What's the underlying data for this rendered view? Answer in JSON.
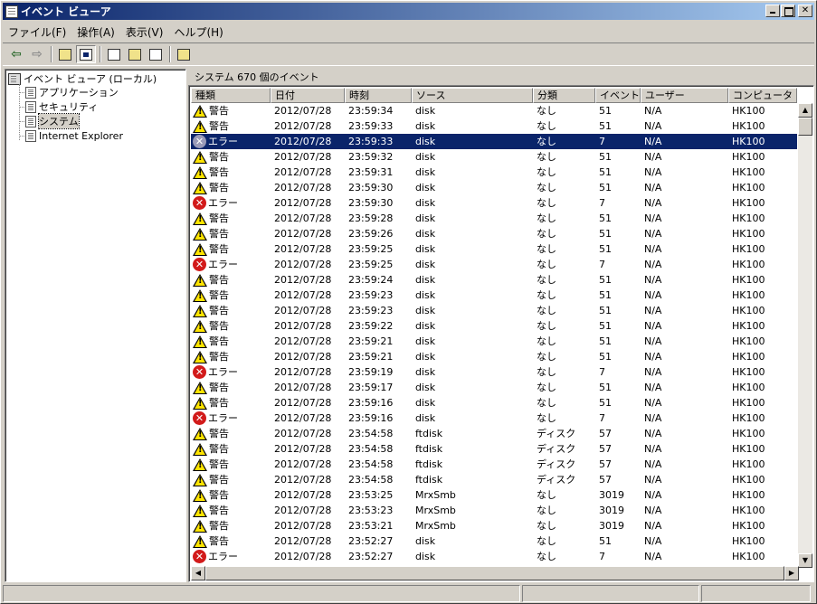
{
  "window": {
    "title": "イベント ビューア"
  },
  "menu": [
    "ファイル(F)",
    "操作(A)",
    "表示(V)",
    "ヘルプ(H)"
  ],
  "tree": {
    "root": "イベント ビューア (ローカル)",
    "items": [
      "アプリケーション",
      "セキュリティ",
      "システム",
      "Internet Explorer"
    ],
    "selected_index": 2
  },
  "pane": {
    "header": "システム    670 個のイベント"
  },
  "columns": [
    "種類",
    "日付",
    "時刻",
    "ソース",
    "分類",
    "イベント",
    "ユーザー",
    "コンピュータ"
  ],
  "colors": {
    "selection": "#0a246a",
    "error": "#d21a1a",
    "warning": "#ffe400"
  },
  "icons": {
    "warning": "warning-icon",
    "error": "error-icon"
  },
  "selected_row": 2,
  "rows": [
    {
      "type": "warning",
      "label": "警告",
      "date": "2012/07/28",
      "time": "23:59:34",
      "source": "disk",
      "category": "なし",
      "event": "51",
      "user": "N/A",
      "computer": "HK100"
    },
    {
      "type": "warning",
      "label": "警告",
      "date": "2012/07/28",
      "time": "23:59:33",
      "source": "disk",
      "category": "なし",
      "event": "51",
      "user": "N/A",
      "computer": "HK100"
    },
    {
      "type": "error",
      "label": "エラー",
      "date": "2012/07/28",
      "time": "23:59:33",
      "source": "disk",
      "category": "なし",
      "event": "7",
      "user": "N/A",
      "computer": "HK100"
    },
    {
      "type": "warning",
      "label": "警告",
      "date": "2012/07/28",
      "time": "23:59:32",
      "source": "disk",
      "category": "なし",
      "event": "51",
      "user": "N/A",
      "computer": "HK100"
    },
    {
      "type": "warning",
      "label": "警告",
      "date": "2012/07/28",
      "time": "23:59:31",
      "source": "disk",
      "category": "なし",
      "event": "51",
      "user": "N/A",
      "computer": "HK100"
    },
    {
      "type": "warning",
      "label": "警告",
      "date": "2012/07/28",
      "time": "23:59:30",
      "source": "disk",
      "category": "なし",
      "event": "51",
      "user": "N/A",
      "computer": "HK100"
    },
    {
      "type": "error",
      "label": "エラー",
      "date": "2012/07/28",
      "time": "23:59:30",
      "source": "disk",
      "category": "なし",
      "event": "7",
      "user": "N/A",
      "computer": "HK100"
    },
    {
      "type": "warning",
      "label": "警告",
      "date": "2012/07/28",
      "time": "23:59:28",
      "source": "disk",
      "category": "なし",
      "event": "51",
      "user": "N/A",
      "computer": "HK100"
    },
    {
      "type": "warning",
      "label": "警告",
      "date": "2012/07/28",
      "time": "23:59:26",
      "source": "disk",
      "category": "なし",
      "event": "51",
      "user": "N/A",
      "computer": "HK100"
    },
    {
      "type": "warning",
      "label": "警告",
      "date": "2012/07/28",
      "time": "23:59:25",
      "source": "disk",
      "category": "なし",
      "event": "51",
      "user": "N/A",
      "computer": "HK100"
    },
    {
      "type": "error",
      "label": "エラー",
      "date": "2012/07/28",
      "time": "23:59:25",
      "source": "disk",
      "category": "なし",
      "event": "7",
      "user": "N/A",
      "computer": "HK100"
    },
    {
      "type": "warning",
      "label": "警告",
      "date": "2012/07/28",
      "time": "23:59:24",
      "source": "disk",
      "category": "なし",
      "event": "51",
      "user": "N/A",
      "computer": "HK100"
    },
    {
      "type": "warning",
      "label": "警告",
      "date": "2012/07/28",
      "time": "23:59:23",
      "source": "disk",
      "category": "なし",
      "event": "51",
      "user": "N/A",
      "computer": "HK100"
    },
    {
      "type": "warning",
      "label": "警告",
      "date": "2012/07/28",
      "time": "23:59:23",
      "source": "disk",
      "category": "なし",
      "event": "51",
      "user": "N/A",
      "computer": "HK100"
    },
    {
      "type": "warning",
      "label": "警告",
      "date": "2012/07/28",
      "time": "23:59:22",
      "source": "disk",
      "category": "なし",
      "event": "51",
      "user": "N/A",
      "computer": "HK100"
    },
    {
      "type": "warning",
      "label": "警告",
      "date": "2012/07/28",
      "time": "23:59:21",
      "source": "disk",
      "category": "なし",
      "event": "51",
      "user": "N/A",
      "computer": "HK100"
    },
    {
      "type": "warning",
      "label": "警告",
      "date": "2012/07/28",
      "time": "23:59:21",
      "source": "disk",
      "category": "なし",
      "event": "51",
      "user": "N/A",
      "computer": "HK100"
    },
    {
      "type": "error",
      "label": "エラー",
      "date": "2012/07/28",
      "time": "23:59:19",
      "source": "disk",
      "category": "なし",
      "event": "7",
      "user": "N/A",
      "computer": "HK100"
    },
    {
      "type": "warning",
      "label": "警告",
      "date": "2012/07/28",
      "time": "23:59:17",
      "source": "disk",
      "category": "なし",
      "event": "51",
      "user": "N/A",
      "computer": "HK100"
    },
    {
      "type": "warning",
      "label": "警告",
      "date": "2012/07/28",
      "time": "23:59:16",
      "source": "disk",
      "category": "なし",
      "event": "51",
      "user": "N/A",
      "computer": "HK100"
    },
    {
      "type": "error",
      "label": "エラー",
      "date": "2012/07/28",
      "time": "23:59:16",
      "source": "disk",
      "category": "なし",
      "event": "7",
      "user": "N/A",
      "computer": "HK100"
    },
    {
      "type": "warning",
      "label": "警告",
      "date": "2012/07/28",
      "time": "23:54:58",
      "source": "ftdisk",
      "category": "ディスク",
      "event": "57",
      "user": "N/A",
      "computer": "HK100"
    },
    {
      "type": "warning",
      "label": "警告",
      "date": "2012/07/28",
      "time": "23:54:58",
      "source": "ftdisk",
      "category": "ディスク",
      "event": "57",
      "user": "N/A",
      "computer": "HK100"
    },
    {
      "type": "warning",
      "label": "警告",
      "date": "2012/07/28",
      "time": "23:54:58",
      "source": "ftdisk",
      "category": "ディスク",
      "event": "57",
      "user": "N/A",
      "computer": "HK100"
    },
    {
      "type": "warning",
      "label": "警告",
      "date": "2012/07/28",
      "time": "23:54:58",
      "source": "ftdisk",
      "category": "ディスク",
      "event": "57",
      "user": "N/A",
      "computer": "HK100"
    },
    {
      "type": "warning",
      "label": "警告",
      "date": "2012/07/28",
      "time": "23:53:25",
      "source": "MrxSmb",
      "category": "なし",
      "event": "3019",
      "user": "N/A",
      "computer": "HK100"
    },
    {
      "type": "warning",
      "label": "警告",
      "date": "2012/07/28",
      "time": "23:53:23",
      "source": "MrxSmb",
      "category": "なし",
      "event": "3019",
      "user": "N/A",
      "computer": "HK100"
    },
    {
      "type": "warning",
      "label": "警告",
      "date": "2012/07/28",
      "time": "23:53:21",
      "source": "MrxSmb",
      "category": "なし",
      "event": "3019",
      "user": "N/A",
      "computer": "HK100"
    },
    {
      "type": "warning",
      "label": "警告",
      "date": "2012/07/28",
      "time": "23:52:27",
      "source": "disk",
      "category": "なし",
      "event": "51",
      "user": "N/A",
      "computer": "HK100"
    },
    {
      "type": "error",
      "label": "エラー",
      "date": "2012/07/28",
      "time": "23:52:27",
      "source": "disk",
      "category": "なし",
      "event": "7",
      "user": "N/A",
      "computer": "HK100"
    }
  ]
}
